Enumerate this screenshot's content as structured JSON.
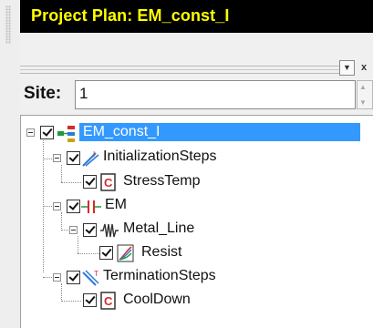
{
  "window": {
    "title": "Project Plan: EM_const_I"
  },
  "toolbar": {
    "dropdown_icon": "chevron-down-icon",
    "close_label": "x"
  },
  "site": {
    "label": "Site:",
    "value": "1"
  },
  "tree": {
    "root": {
      "label": "EM_const_I",
      "icon": "project-tree-icon",
      "selected": true,
      "checked": true
    },
    "items": [
      {
        "label": "InitializationSteps",
        "icon": "init-steps-icon",
        "checked": true
      },
      {
        "label": "StressTemp",
        "icon": "script-step-icon",
        "checked": true
      },
      {
        "label": "EM",
        "icon": "em-icon",
        "checked": true
      },
      {
        "label": "Metal_Line",
        "icon": "waveform-icon",
        "checked": true
      },
      {
        "label": "Resist",
        "icon": "chart-icon",
        "checked": true
      },
      {
        "label": "TerminationSteps",
        "icon": "term-steps-icon",
        "checked": true
      },
      {
        "label": "CoolDown",
        "icon": "script-step-icon",
        "checked": true
      }
    ]
  },
  "colors": {
    "titlebar_bg": "#000000",
    "titlebar_text": "#ffff00",
    "selection": "#3399ff"
  }
}
